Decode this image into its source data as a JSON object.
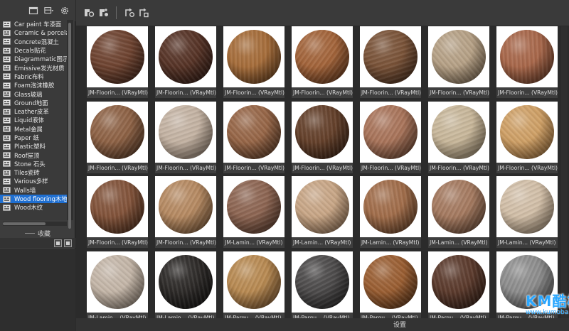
{
  "left_panel": {
    "toolbar_icons": [
      "window-icon",
      "layout-icon",
      "settings-icon"
    ],
    "categories": [
      {
        "label": "Car paint 车漆面"
      },
      {
        "label": "Ceramic & porcelai"
      },
      {
        "label": "Concrete混凝土"
      },
      {
        "label": "Decals贴花"
      },
      {
        "label": "Diagrammatic图示"
      },
      {
        "label": "Emissive发光材质"
      },
      {
        "label": "Fabric布料"
      },
      {
        "label": "Foam泡沫橡胶"
      },
      {
        "label": "Glass玻璃"
      },
      {
        "label": "Ground地面"
      },
      {
        "label": "Leather皮革"
      },
      {
        "label": "Liquid液体"
      },
      {
        "label": "Metal金属"
      },
      {
        "label": "Paper 纸"
      },
      {
        "label": "Plastic塑料"
      },
      {
        "label": "Roof屋顶"
      },
      {
        "label": "Stone 石头"
      },
      {
        "label": "Tiles瓷砖"
      },
      {
        "label": "Various多样"
      },
      {
        "label": "Walls墙"
      },
      {
        "label": "Wood flooring木地板"
      },
      {
        "label": "Wood木纹"
      }
    ],
    "selected_category": "Wood flooring木地板",
    "favorites_label": "收藏"
  },
  "right_panel": {
    "toolbar_icons": [
      "render-material-icon",
      "add-material-icon",
      "refresh-icon",
      "reload-icon"
    ],
    "materials": [
      {
        "name": "JM-Floorin... (VRayMtl)",
        "color": "#6e4330",
        "color2": "#3d2217"
      },
      {
        "name": "JM-Floorin... (VRayMtl)",
        "color": "#563326",
        "color2": "#2a1711"
      },
      {
        "name": "JM-Floorin... (VRayMtl)",
        "color": "#a66d3a",
        "color2": "#5a3618"
      },
      {
        "name": "JM-Floorin... (VRayMtl)",
        "color": "#a3643a",
        "color2": "#5a3016"
      },
      {
        "name": "JM-Floorin... (VRayMtl)",
        "color": "#7a5338",
        "color2": "#3f2617"
      },
      {
        "name": "JM-Floorin... (VRayMtl)",
        "color": "#b6a186",
        "color2": "#6c5a45"
      },
      {
        "name": "JM-Floorin... (VRayMtl)",
        "color": "#a8674a",
        "color2": "#5b321f"
      },
      {
        "name": "JM-Floorin... (VRayMtl)",
        "color": "#8e6245",
        "color2": "#4b301e"
      },
      {
        "name": "JM-Floorin... (VRayMtl)",
        "color": "#c4b3a3",
        "color2": "#7b6a5b"
      },
      {
        "name": "JM-Floorin... (VRayMtl)",
        "color": "#976647",
        "color2": "#50321f"
      },
      {
        "name": "JM-Floorin... (VRayMtl)",
        "color": "#64402a",
        "color2": "#321d11"
      },
      {
        "name": "JM-Floorin... (VRayMtl)",
        "color": "#a9745a",
        "color2": "#5c3a28"
      },
      {
        "name": "JM-Floorin... (VRayMtl)",
        "color": "#c8b79a",
        "color2": "#7f6f57"
      },
      {
        "name": "JM-Floorin... (VRayMtl)",
        "color": "#cfa066",
        "color2": "#8a5f30"
      },
      {
        "name": "JM-Floorin... (VRayMtl)",
        "color": "#82533a",
        "color2": "#432716"
      },
      {
        "name": "JM-Floorin... (VRayMtl)",
        "color": "#b68a62",
        "color2": "#6b4b2e"
      },
      {
        "name": "JM-Lamin... (VRayMtl)",
        "color": "#8d6552",
        "color2": "#4c3022"
      },
      {
        "name": "JM-Lamin... (VRayMtl)",
        "color": "#c8a686",
        "color2": "#7e6046"
      },
      {
        "name": "JM-Lamin... (VRayMtl)",
        "color": "#a16d4a",
        "color2": "#593820"
      },
      {
        "name": "JM-Lamin... (VRayMtl)",
        "color": "#a57a60",
        "color2": "#5b3f2d"
      },
      {
        "name": "JM-Lamin... (VRayMtl)",
        "color": "#d2bfa8",
        "color2": "#8a7760"
      },
      {
        "name": "JM-Lamin... (VRayMtl)",
        "color": "#c4b6a8",
        "color2": "#7a6d60"
      },
      {
        "name": "JM-Lamin... (VRayMtl)",
        "color": "#2d2a28",
        "color2": "#0f0e0d"
      },
      {
        "name": "JM-Parqu... (VRayMtl)",
        "color": "#b88a52",
        "color2": "#6a4624"
      },
      {
        "name": "JM-Parqu... (VRayMtl)",
        "color": "#4c4a4a",
        "color2": "#1f1e1e"
      },
      {
        "name": "JM-Parqu... (VRayMtl)",
        "color": "#9a5e32",
        "color2": "#4f2c12"
      },
      {
        "name": "JM-Parqu... (VRayMtl)",
        "color": "#5b3a2c",
        "color2": "#2b1911"
      },
      {
        "name": "JM-Parqu... (VRayMtl)",
        "color": "#8d8d8d",
        "color2": "#474747"
      }
    ],
    "status_label": "设置"
  },
  "watermark": {
    "main": "KM酷模吧",
    "url": "www.kumoba.com"
  },
  "colors": {
    "panel_bg": "#3d3d3d",
    "selection": "#1f6fd1",
    "swatch_bg": "#ffffff"
  }
}
